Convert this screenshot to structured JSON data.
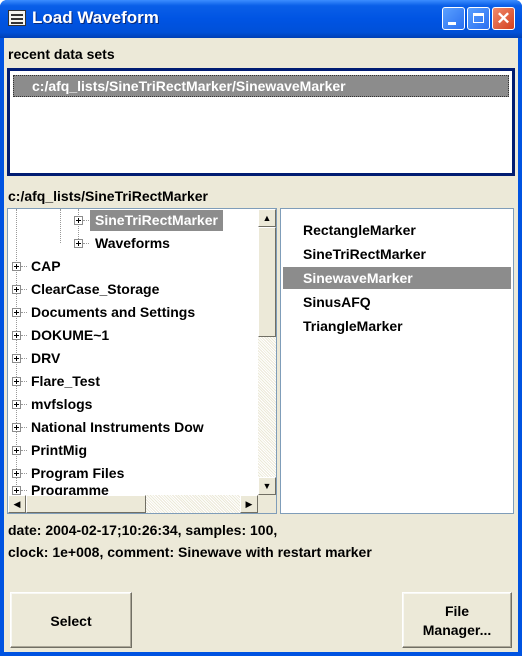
{
  "window": {
    "title": "Load Waveform",
    "icon": "grid-app-icon",
    "controls": {
      "minimize": "minimize-icon",
      "maximize": "maximize-icon",
      "close": "✕"
    }
  },
  "recent": {
    "label": "recent data sets",
    "items": [
      "c:/afq_lists/SineTriRectMarker/SinewaveMarker"
    ],
    "selected_index": 0
  },
  "path": {
    "current": "c:/afq_lists/SineTriRectMarker"
  },
  "tree": {
    "items": [
      {
        "label": "SineTriRectMarker",
        "level": 2,
        "selected": true
      },
      {
        "label": "Waveforms",
        "level": 2,
        "selected": false
      },
      {
        "label": "CAP",
        "level": 0,
        "selected": false
      },
      {
        "label": "ClearCase_Storage",
        "level": 0,
        "selected": false
      },
      {
        "label": "Documents and Settings",
        "level": 0,
        "selected": false
      },
      {
        "label": "DOKUME~1",
        "level": 0,
        "selected": false
      },
      {
        "label": "DRV",
        "level": 0,
        "selected": false
      },
      {
        "label": "Flare_Test",
        "level": 0,
        "selected": false
      },
      {
        "label": "mvfslogs",
        "level": 0,
        "selected": false
      },
      {
        "label": "National Instruments Dow",
        "level": 0,
        "selected": false
      },
      {
        "label": "PrintMig",
        "level": 0,
        "selected": false
      },
      {
        "label": "Program Files",
        "level": 0,
        "selected": false
      },
      {
        "label": "Programme",
        "level": 0,
        "selected": false
      }
    ],
    "scroll": {
      "up": "▲",
      "down": "▼",
      "left": "◀",
      "right": "▶"
    }
  },
  "files": {
    "items": [
      "RectangleMarker",
      "SineTriRectMarker",
      "SinewaveMarker",
      "SinusAFQ",
      "TriangleMarker"
    ],
    "selected_index": 2
  },
  "info": {
    "line1": "date: 2004-02-17;10:26:34, samples: 100,",
    "line2": "clock: 1e+008, comment: Sinewave with restart marker"
  },
  "buttons": {
    "select": "Select",
    "file_manager_line1": "File",
    "file_manager_line2": "Manager..."
  },
  "colors": {
    "title_bar": "#0054e3",
    "selection": "#8c8c8c",
    "dialog_bg": "#ece9d8",
    "recent_border": "#001c72"
  }
}
